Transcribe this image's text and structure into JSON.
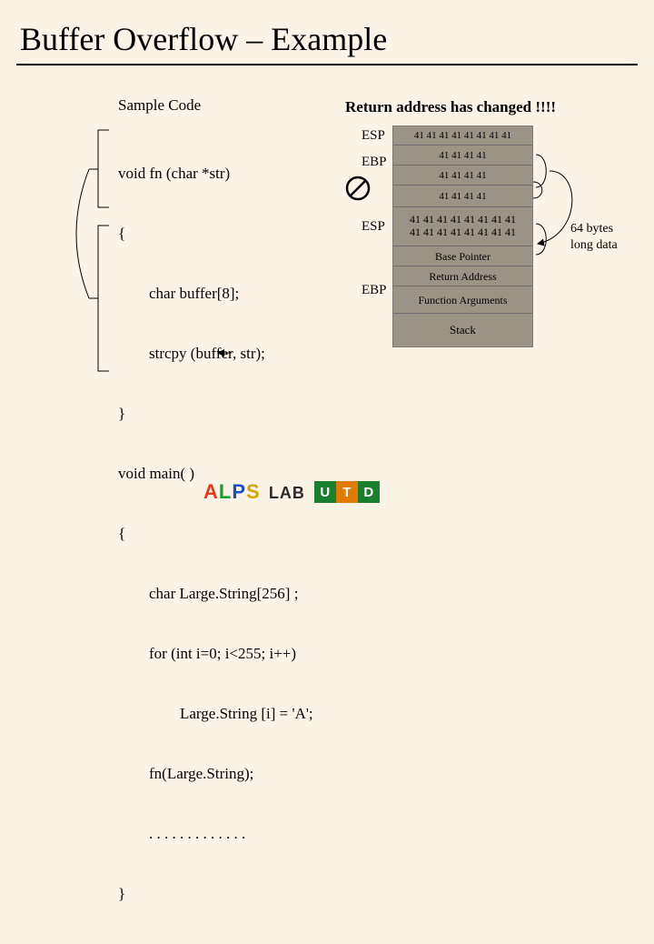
{
  "title": "Buffer Overflow – Example",
  "labels": {
    "sample_code": "Sample Code",
    "return_changed": "Return address has changed !!!!",
    "esp": "ESP",
    "ebp": "EBP"
  },
  "code": {
    "l0": "void fn (char *str)",
    "l1": "{",
    "l2": "char buffer[8];",
    "l3": "strcpy (buffer, str);",
    "l4": "}",
    "l5": "void main( )",
    "l6": "{",
    "l7": "char Large.String[256] ;",
    "l8": "for (int i=0; i<255; i++)",
    "l9": "Large.String [i] = 'A';",
    "l10": "fn(Large.String);",
    "l11": ". . . . . . . . . . . . .",
    "l12": "}"
  },
  "stack": {
    "buf8_line1": "41 41 41 41 41 41 41 41",
    "ebp_overwritten": "41 41 41 41",
    "ret_overwritten": "41 41 41 41",
    "arg_overwritten": "41 41 41 41",
    "buf256_line1": "41 41 41 41 41 41 41 41",
    "buf256_line2": "41 41 41 41 41 41 41 41",
    "base_pointer": "Base Pointer",
    "return_address": "Return Address",
    "function_arguments": "Function Arguments",
    "stack_label": "Stack"
  },
  "side_note": {
    "l1": "64 bytes",
    "l2": "long data"
  },
  "logo": {
    "alps_letters": [
      "A",
      "L",
      "P",
      "S"
    ],
    "alps_suffix": "LAB",
    "alps_colors": [
      "#e63a1e",
      "#1d9a2f",
      "#1b4fbf",
      "#d9a400"
    ],
    "utd_letters": [
      "U",
      "T",
      "D"
    ],
    "utd_colors": [
      "#1a7f2e",
      "#e07a00",
      "#1a7f2e"
    ]
  }
}
